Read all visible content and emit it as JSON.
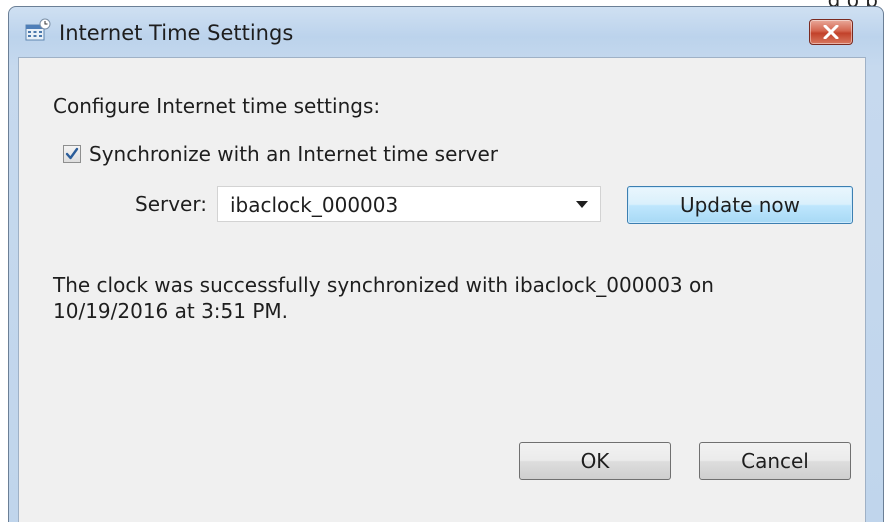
{
  "background": {
    "partial_text": "g    o    p"
  },
  "dialog": {
    "title": "Internet Time Settings",
    "icons": {
      "title": "clock-calendar-icon",
      "close": "close-icon",
      "check": "checkmark-icon",
      "dropdown": "chevron-down-icon"
    },
    "heading": "Configure Internet time settings:",
    "sync_checkbox": {
      "label": "Synchronize with an Internet time server",
      "checked": true
    },
    "server": {
      "label": "Server:",
      "value": "ibaclock_000003"
    },
    "update_button": "Update now",
    "status_line1": "The clock was successfully synchronized with ibaclock_000003 on",
    "status_line2": "10/19/2016 at 3:51 PM.",
    "ok_button": "OK",
    "cancel_button": "Cancel"
  },
  "colors": {
    "frame_top": "#cfe0f2",
    "client_bg": "#f0f0f0",
    "close_red": "#c2412a",
    "default_button_blue": "#3c7fb1"
  }
}
